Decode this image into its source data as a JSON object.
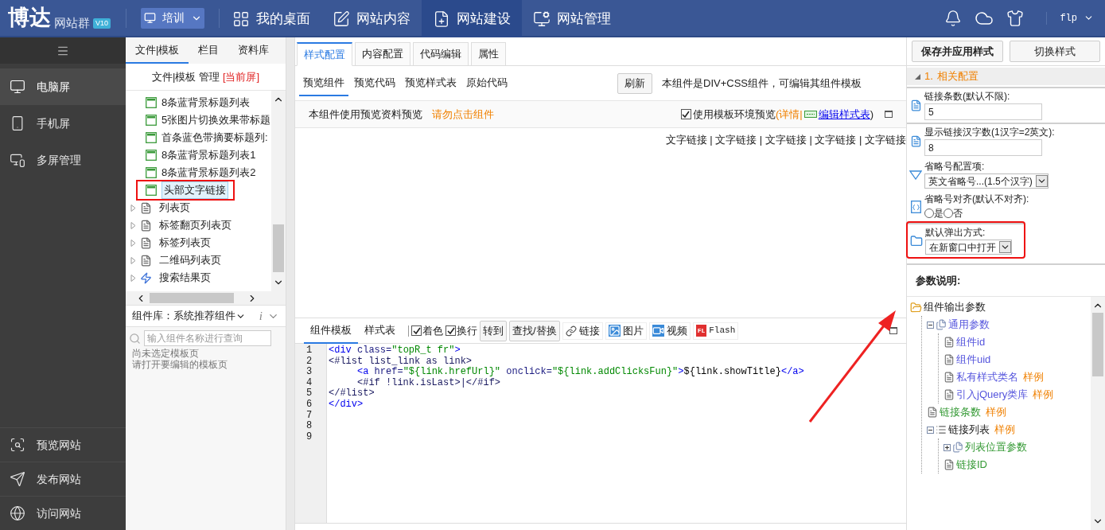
{
  "header": {
    "logo": "博达",
    "product": "网站群",
    "version": "V10",
    "site_selector": "培训",
    "user": "flp",
    "nav": [
      {
        "label": "我的桌面",
        "selected": false
      },
      {
        "label": "网站内容",
        "selected": false
      },
      {
        "label": "网站建设",
        "selected": true
      },
      {
        "label": "网站管理",
        "selected": false
      }
    ]
  },
  "sidebar": {
    "items": [
      {
        "label": "电脑屏",
        "selected": true
      },
      {
        "label": "手机屏",
        "selected": false
      },
      {
        "label": "多屏管理",
        "selected": false
      }
    ],
    "bottom_items": [
      "预览网站",
      "发布网站",
      "访问网站"
    ]
  },
  "file_panel": {
    "tabs": [
      {
        "label": "文件|模板",
        "selected": true
      },
      {
        "label": "栏目",
        "selected": false
      },
      {
        "label": "资料库",
        "selected": false
      }
    ],
    "heading": "文件|模板 管理",
    "heading_tag": "[当前屏]",
    "components": [
      {
        "label": "8条蓝背景标题列表",
        "selected": false,
        "highlighted": false
      },
      {
        "label": "5张图片切换效果带标题",
        "selected": false,
        "highlighted": false
      },
      {
        "label": "首条蓝色带摘要标题列:",
        "selected": false,
        "highlighted": false
      },
      {
        "label": "8条蓝背景标题列表1",
        "selected": false,
        "highlighted": false
      },
      {
        "label": "8条蓝背景标题列表2",
        "selected": false,
        "highlighted": false
      },
      {
        "label": "头部文字链接",
        "selected": true,
        "highlighted": true
      }
    ],
    "pages": [
      {
        "label": "列表页",
        "kind": "page",
        "expanded": false
      },
      {
        "label": "标签翻页列表页",
        "kind": "page",
        "expanded": false
      },
      {
        "label": "标签列表页",
        "kind": "page",
        "expanded": false
      },
      {
        "label": "二维码列表页",
        "kind": "page",
        "expanded": false
      },
      {
        "label": "搜索结果页",
        "kind": "search",
        "expanded": false
      }
    ],
    "library": {
      "label": "组件库：系统推荐组件",
      "info": "i"
    },
    "search": {
      "placeholder": "输入组件名称进行查询"
    },
    "notes": [
      "尚未选定模板页",
      "请打开要编辑的模板页"
    ]
  },
  "editor": {
    "tabs": [
      {
        "label": "样式配置",
        "selected": true
      },
      {
        "label": "内容配置",
        "selected": false
      },
      {
        "label": "代码编辑",
        "selected": false
      },
      {
        "label": "属性",
        "selected": false
      }
    ],
    "preview_tabs": [
      {
        "label": "预览组件",
        "selected": true
      },
      {
        "label": "预览代码",
        "selected": false
      },
      {
        "label": "预览样式表",
        "selected": false
      },
      {
        "label": "原始代码",
        "selected": false
      }
    ],
    "refresh": "刷新",
    "note": "本组件是DIV+CSS组件，可编辑其组件模板",
    "preview_bar": {
      "text": "本组件使用预览资料预览",
      "warning": "请勿点击组件",
      "env_label": "使用模板环境预览",
      "env_checked": true,
      "details": "(详情|",
      "edit_link": "编辑样式表",
      "close_paren": ")"
    },
    "preview_links": "文字链接 | 文字链接 | 文字链接 | 文字链接 | 文字链接",
    "code_tabs": [
      {
        "label": "组件模板",
        "selected": true
      },
      {
        "label": "样式表",
        "selected": false
      }
    ],
    "toggles": [
      {
        "label": "着色",
        "checked": true
      },
      {
        "label": "换行",
        "checked": true
      }
    ],
    "tools": [
      {
        "kind": "button",
        "label": "转到"
      },
      {
        "kind": "button",
        "label": "查找/替换"
      },
      {
        "kind": "link",
        "label": "链接"
      },
      {
        "kind": "image",
        "label": "图片"
      },
      {
        "kind": "video",
        "label": "视频"
      },
      {
        "kind": "flash",
        "label": "Flash",
        "badge": "FL"
      }
    ],
    "line_numbers": [
      "1",
      "2",
      "3",
      "4",
      "5",
      "6",
      "7",
      "8",
      "9"
    ],
    "code_lines": [
      [
        {
          "text": "<div",
          "kind": "tag"
        },
        {
          "text": " class=",
          "kind": "attr"
        },
        {
          "text": "\"topR_t fr\"",
          "kind": "str"
        },
        {
          "text": ">",
          "kind": "tag"
        }
      ],
      [
        {
          "text": "<#list list_link as link>",
          "kind": "ftl"
        }
      ],
      [
        {
          "text": "     <a",
          "kind": "tag"
        },
        {
          "text": " href=",
          "kind": "attr"
        },
        {
          "text": "\"${link.hrefUrl}\"",
          "kind": "str"
        },
        {
          "text": " onclick=",
          "kind": "attr"
        },
        {
          "text": "\"${link.addClicksFun}\"",
          "kind": "str"
        },
        {
          "text": ">",
          "kind": "tag"
        },
        {
          "text": "${link.showTitle}",
          "kind": "plain"
        },
        {
          "text": "</a>",
          "kind": "tag"
        }
      ],
      [
        {
          "text": "     <#if !link.isLast>|</#if>",
          "kind": "ftl"
        }
      ],
      [
        {
          "text": "</#list>",
          "kind": "ftl"
        }
      ],
      [
        {
          "text": "</div>",
          "kind": "tag"
        }
      ]
    ]
  },
  "style_panel": {
    "buttons": [
      "保存并应用样式",
      "切换样式"
    ],
    "section": {
      "number": "1.",
      "title": "相关配置",
      "expanded": true
    },
    "fields": [
      {
        "kind": "text",
        "label": "链接条数(默认不限):",
        "value": "5",
        "divider_above": true,
        "highlighted": false
      },
      {
        "kind": "text",
        "label": "显示链接汉字数(1汉字=2英文):",
        "value": "8",
        "divider_above": true,
        "highlighted": false
      },
      {
        "kind": "select",
        "label": "省略号配置项:",
        "value": "英文省略号...(1.5个汉字)",
        "divider_above": false,
        "highlighted": false
      },
      {
        "kind": "radio",
        "label": "省略号对齐(默认不对齐):",
        "options": [
          {
            "label": "是",
            "selected": false
          },
          {
            "label": "否",
            "selected": false
          }
        ],
        "divider_above": false,
        "highlighted": false
      },
      {
        "kind": "select_folder",
        "label": "默认弹出方式:",
        "value": "在新窗口中打开",
        "divider_above": true,
        "highlighted": true
      }
    ],
    "params_title": "参数说明:",
    "params_tree": [
      {
        "label": "组件输出参数",
        "kind": "folder",
        "color": "#222222",
        "children": [
          {
            "label": "通用参数",
            "kind": "group",
            "color": "#5555dd",
            "expanded": true,
            "children": [
              {
                "label": "组件id",
                "kind": "leaf",
                "color": "#5555dd"
              },
              {
                "label": "组件uid",
                "kind": "leaf",
                "color": "#5555dd"
              },
              {
                "label": "私有样式类名",
                "kind": "leaf",
                "color": "#5555dd",
                "sample": "样例"
              },
              {
                "label": "引入jQuery类库",
                "kind": "leaf",
                "color": "#5555dd",
                "sample": "样例"
              }
            ]
          },
          {
            "label": "链接条数",
            "kind": "leaf",
            "color": "#339933",
            "sample": "样例"
          },
          {
            "label": "链接列表",
            "kind": "list",
            "color": "#222222",
            "sample": "样例",
            "expanded": true,
            "children": [
              {
                "label": "列表位置参数",
                "kind": "group",
                "color": "#339933",
                "expanded": false
              },
              {
                "label": "链接ID",
                "kind": "leaf",
                "color": "#339933"
              }
            ]
          }
        ]
      }
    ]
  }
}
